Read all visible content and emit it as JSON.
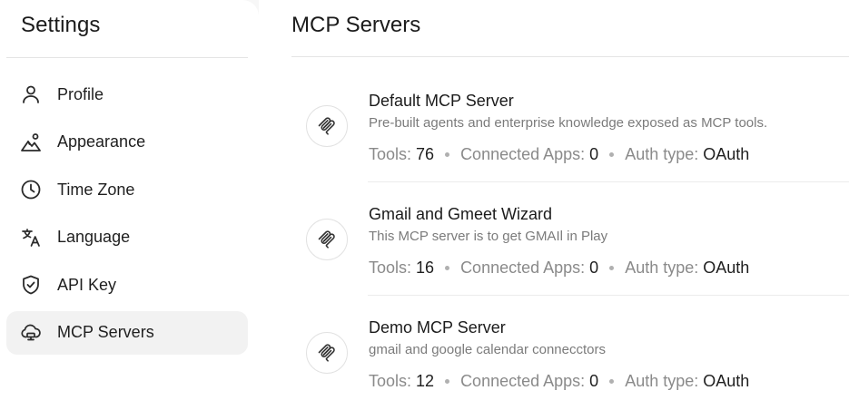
{
  "sidebar": {
    "title": "Settings",
    "items": [
      {
        "label": "Profile",
        "icon": "user-icon"
      },
      {
        "label": "Appearance",
        "icon": "appearance-icon"
      },
      {
        "label": "Time Zone",
        "icon": "clock-icon"
      },
      {
        "label": "Language",
        "icon": "translate-icon"
      },
      {
        "label": "API Key",
        "icon": "shield-check-icon"
      },
      {
        "label": "MCP Servers",
        "icon": "cloud-server-icon",
        "active": true
      }
    ]
  },
  "main": {
    "title": "MCP Servers",
    "labels": {
      "tools": "Tools:",
      "connected_apps": "Connected Apps:",
      "auth_type": "Auth type:"
    },
    "servers": [
      {
        "name": "Default MCP Server",
        "description": "Pre-built agents and enterprise knowledge exposed as MCP tools.",
        "tools": "76",
        "connected_apps": "0",
        "auth_type": "OAuth"
      },
      {
        "name": "Gmail and Gmeet Wizard",
        "description": "This MCP server is to get GMAIl in Play",
        "tools": "16",
        "connected_apps": "0",
        "auth_type": "OAuth"
      },
      {
        "name": "Demo MCP Server",
        "description": "gmail and google calendar connecctors",
        "tools": "12",
        "connected_apps": "0",
        "auth_type": "OAuth"
      }
    ]
  },
  "colors": {
    "active_bg": "#f2f2f2",
    "muted_text": "#8a8a8a"
  }
}
